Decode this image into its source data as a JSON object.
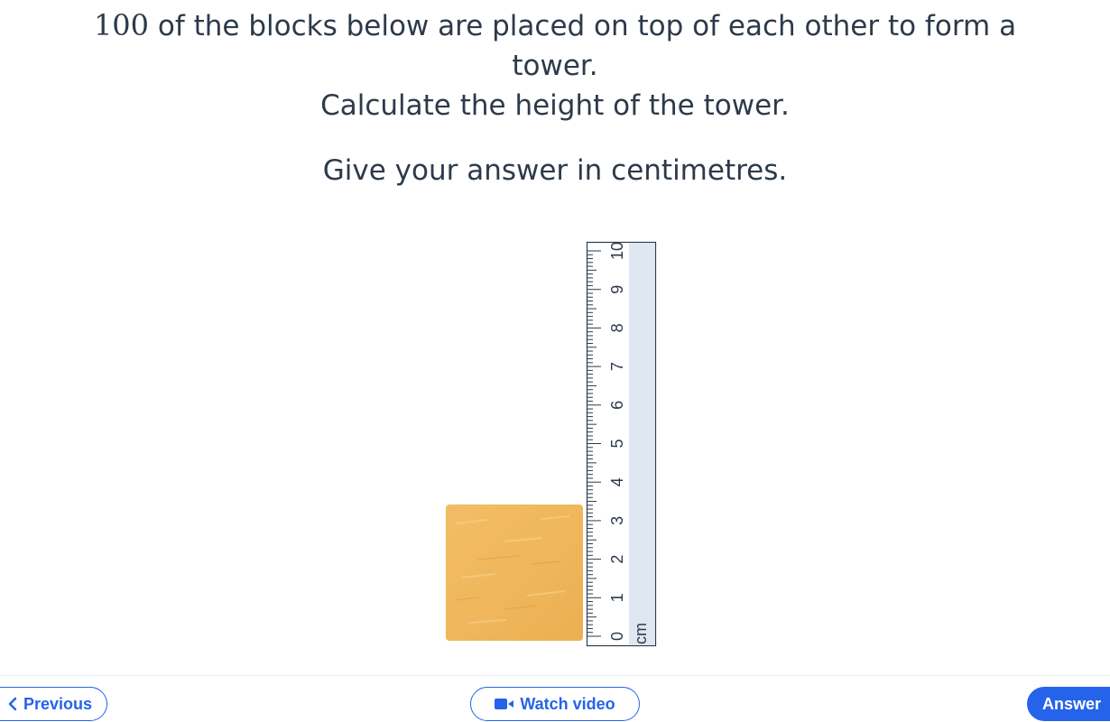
{
  "question": {
    "number": "100",
    "line1_rest": " of the blocks below are placed on top of each other to form a",
    "line2": "tower.",
    "line3": "Calculate the height of the tower.",
    "line4": "Give your answer in centimetres."
  },
  "ruler": {
    "unit_label": "cm",
    "tick_labels": [
      "0",
      "1",
      "2",
      "3",
      "4",
      "5",
      "6",
      "7",
      "8",
      "9",
      "10"
    ]
  },
  "block": {
    "color": "#f0b65a"
  },
  "footer": {
    "previous_label": "Previous",
    "watch_video_label": "Watch video",
    "answer_label": "Answer"
  },
  "colors": {
    "accent": "#2563eb",
    "text": "#2d3a4b",
    "ruler_fill": "#dfe7f0"
  }
}
